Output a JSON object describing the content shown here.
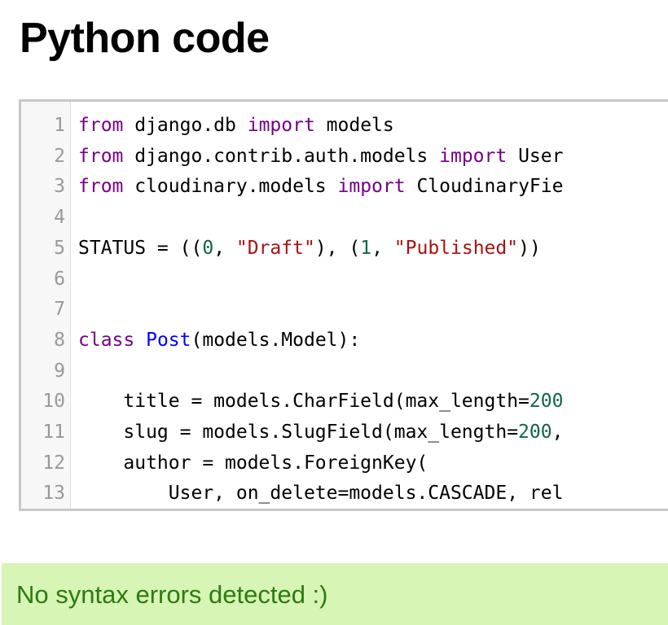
{
  "page": {
    "title": "Python code"
  },
  "editor": {
    "lines": [
      {
        "number": "1",
        "tokens": [
          {
            "t": "from",
            "c": "keyword"
          },
          {
            "t": " django.db ",
            "c": "plain"
          },
          {
            "t": "import",
            "c": "keyword"
          },
          {
            "t": " models",
            "c": "plain"
          }
        ]
      },
      {
        "number": "2",
        "tokens": [
          {
            "t": "from",
            "c": "keyword"
          },
          {
            "t": " django.contrib.auth.models ",
            "c": "plain"
          },
          {
            "t": "import",
            "c": "keyword"
          },
          {
            "t": " User",
            "c": "plain"
          }
        ]
      },
      {
        "number": "3",
        "tokens": [
          {
            "t": "from",
            "c": "keyword"
          },
          {
            "t": " cloudinary.models ",
            "c": "plain"
          },
          {
            "t": "import",
            "c": "keyword"
          },
          {
            "t": " CloudinaryFie",
            "c": "plain"
          }
        ]
      },
      {
        "number": "4",
        "tokens": []
      },
      {
        "number": "5",
        "tokens": [
          {
            "t": "STATUS = ((",
            "c": "plain"
          },
          {
            "t": "0",
            "c": "number"
          },
          {
            "t": ", ",
            "c": "plain"
          },
          {
            "t": "\"Draft\"",
            "c": "string"
          },
          {
            "t": "), (",
            "c": "plain"
          },
          {
            "t": "1",
            "c": "number"
          },
          {
            "t": ", ",
            "c": "plain"
          },
          {
            "t": "\"Published\"",
            "c": "string"
          },
          {
            "t": "))",
            "c": "plain"
          }
        ]
      },
      {
        "number": "6",
        "tokens": []
      },
      {
        "number": "7",
        "tokens": []
      },
      {
        "number": "8",
        "tokens": [
          {
            "t": "class",
            "c": "keyword"
          },
          {
            "t": " ",
            "c": "plain"
          },
          {
            "t": "Post",
            "c": "def"
          },
          {
            "t": "(models.Model):",
            "c": "plain"
          }
        ]
      },
      {
        "number": "9",
        "tokens": []
      },
      {
        "number": "10",
        "tokens": [
          {
            "t": "    title = models.CharField(max_length=",
            "c": "plain"
          },
          {
            "t": "200",
            "c": "number"
          }
        ]
      },
      {
        "number": "11",
        "tokens": [
          {
            "t": "    slug = models.SlugField(max_length=",
            "c": "plain"
          },
          {
            "t": "200",
            "c": "number"
          },
          {
            "t": ",",
            "c": "plain"
          }
        ]
      },
      {
        "number": "12",
        "tokens": [
          {
            "t": "    author = models.ForeignKey(",
            "c": "plain"
          }
        ]
      },
      {
        "number": "13",
        "tokens": [
          {
            "t": "        User, on_delete=models.CASCADE, rel",
            "c": "plain"
          }
        ]
      }
    ]
  },
  "status": {
    "message": "No syntax errors detected :)"
  },
  "colors": {
    "keyword": "#770088",
    "def": "#0000ff",
    "number": "#116644",
    "string": "#aa1111",
    "status_background": "#d7f5b4",
    "status_text": "#2d7a12"
  }
}
